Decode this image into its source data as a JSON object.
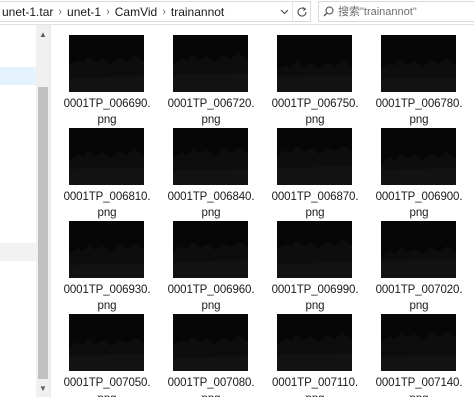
{
  "breadcrumb": {
    "items": [
      "unet-1.tar",
      "unet-1",
      "CamVid",
      "trainannot"
    ],
    "separator": "›"
  },
  "toolbar": {
    "dropdown_icon": "chevron-down-icon",
    "refresh_icon": "refresh-icon"
  },
  "search": {
    "placeholder": "搜索\"trainannot\"",
    "value": "",
    "icon": "search-icon"
  },
  "files": [
    {
      "name_line1": "0001TP_006690.",
      "name_line2": "png"
    },
    {
      "name_line1": "0001TP_006720.",
      "name_line2": "png"
    },
    {
      "name_line1": "0001TP_006750.",
      "name_line2": "png"
    },
    {
      "name_line1": "0001TP_006780.",
      "name_line2": "png"
    },
    {
      "name_line1": "0001TP_006810.",
      "name_line2": "png"
    },
    {
      "name_line1": "0001TP_006840.",
      "name_line2": "png"
    },
    {
      "name_line1": "0001TP_006870.",
      "name_line2": "png"
    },
    {
      "name_line1": "0001TP_006900.",
      "name_line2": "png"
    },
    {
      "name_line1": "0001TP_006930.",
      "name_line2": "png"
    },
    {
      "name_line1": "0001TP_006960.",
      "name_line2": "png"
    },
    {
      "name_line1": "0001TP_006990.",
      "name_line2": "png"
    },
    {
      "name_line1": "0001TP_007020.",
      "name_line2": "png"
    },
    {
      "name_line1": "0001TP_007050.",
      "name_line2": "png"
    },
    {
      "name_line1": "0001TP_007080.",
      "name_line2": "png"
    },
    {
      "name_line1": "0001TP_007110.",
      "name_line2": "png"
    },
    {
      "name_line1": "0001TP_007140.",
      "name_line2": "png"
    }
  ],
  "colors": {
    "thumbnail_background": "#060606",
    "nav_selected": "#e5f3ff",
    "scrollbar_thumb": "#c1c1c1"
  }
}
